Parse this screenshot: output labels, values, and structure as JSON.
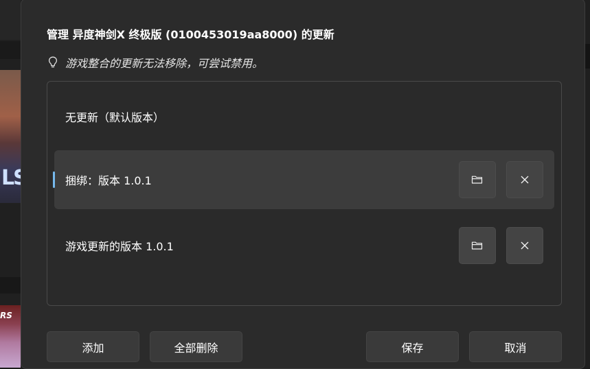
{
  "dialog": {
    "title": "管理 异度神剑X 终极版 (0100453019aa8000) 的更新",
    "hint": "游戏整合的更新无法移除，可尝试禁用。"
  },
  "updates": {
    "items": [
      {
        "label": "无更新（默认版本）",
        "selected": false
      },
      {
        "label": "捆绑：版本 1.0.1",
        "selected": true
      },
      {
        "label": "游戏更新的版本 1.0.1",
        "selected": false
      }
    ]
  },
  "buttons": {
    "add": "添加",
    "remove_all": "全部删除",
    "save": "保存",
    "cancel": "取消"
  },
  "colors": {
    "accent": "#76b9ed",
    "dialog_bg": "#2b2b2b",
    "selected_bg": "#3c3c3c"
  },
  "icons": {
    "hint": "lightbulb-icon",
    "open_folder": "folder-icon",
    "remove": "close-icon"
  }
}
